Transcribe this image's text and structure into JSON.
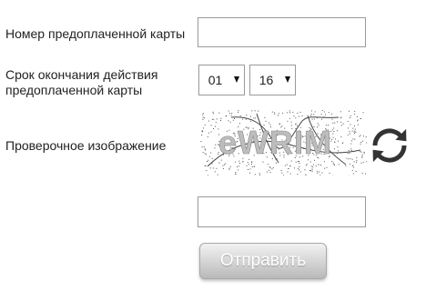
{
  "form": {
    "card_number_label": "Номер предоплаченной карты",
    "card_number_value": "",
    "expiry_label_line1": "Срок окончания действия",
    "expiry_label_line2": "предоплаченной карты",
    "expiry_month": "01",
    "expiry_year": "16",
    "captcha_label": "Проверочное изображение",
    "captcha_text": "eWRIM",
    "captcha_input_value": "",
    "submit_label": "Отправить"
  },
  "icons": {
    "refresh": "refresh-icon",
    "dropdown": "chevron-down-icon"
  },
  "colors": {
    "input_border": "#9a9a9a",
    "button_top": "#f2f2f2",
    "button_bottom": "#b9b9b9",
    "button_text": "#ffffff",
    "refresh_icon": "#333333"
  }
}
